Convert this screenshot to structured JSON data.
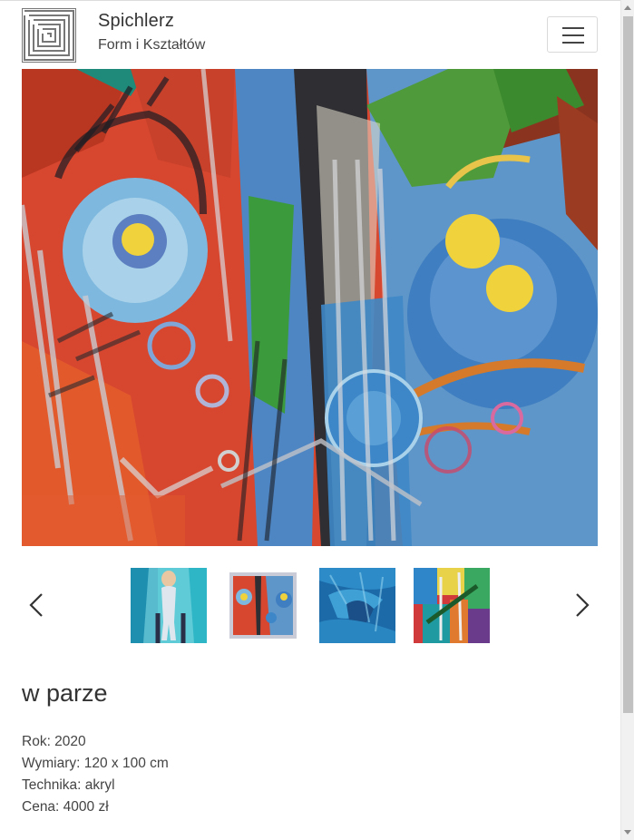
{
  "brand": {
    "title": "Spichlerz",
    "subtitle": "Form i Kształtów"
  },
  "icons": {
    "logo": "labyrinth-logo",
    "menu": "hamburger-icon",
    "prev": "chevron-left-icon",
    "next": "chevron-right-icon"
  },
  "thumbnails": [
    {
      "label": "figure",
      "active": false
    },
    {
      "label": "w parze",
      "active": true
    },
    {
      "label": "blue texture",
      "active": false
    },
    {
      "label": "colour blocks",
      "active": false
    }
  ],
  "artwork": {
    "title": "w parze",
    "year": "Rok: 2020",
    "dimensions": "Wymiary: 120 x 100 cm",
    "technique": "Technika: akryl",
    "price": "Cena: 4000 zł"
  },
  "colors": {
    "accent_red": "#d9442a",
    "accent_blue": "#4f8fcf",
    "accent_yellow": "#f2d23a"
  }
}
